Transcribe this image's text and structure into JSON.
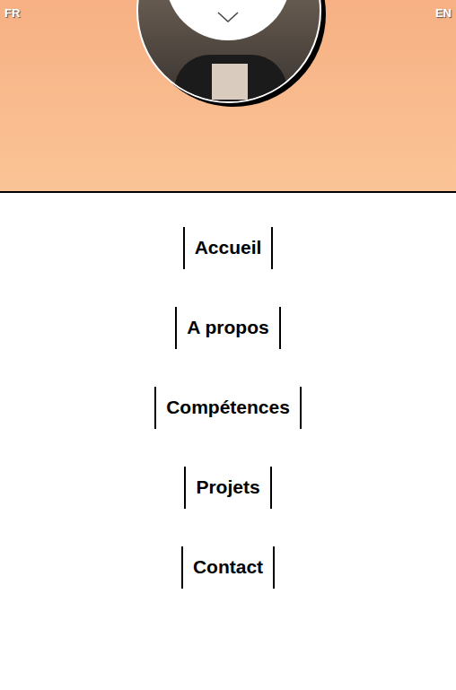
{
  "languages": [
    "FR",
    "EN"
  ],
  "nav": {
    "items": [
      "Accueil",
      "A propos",
      "Compétences",
      "Projets",
      "Contact"
    ]
  }
}
